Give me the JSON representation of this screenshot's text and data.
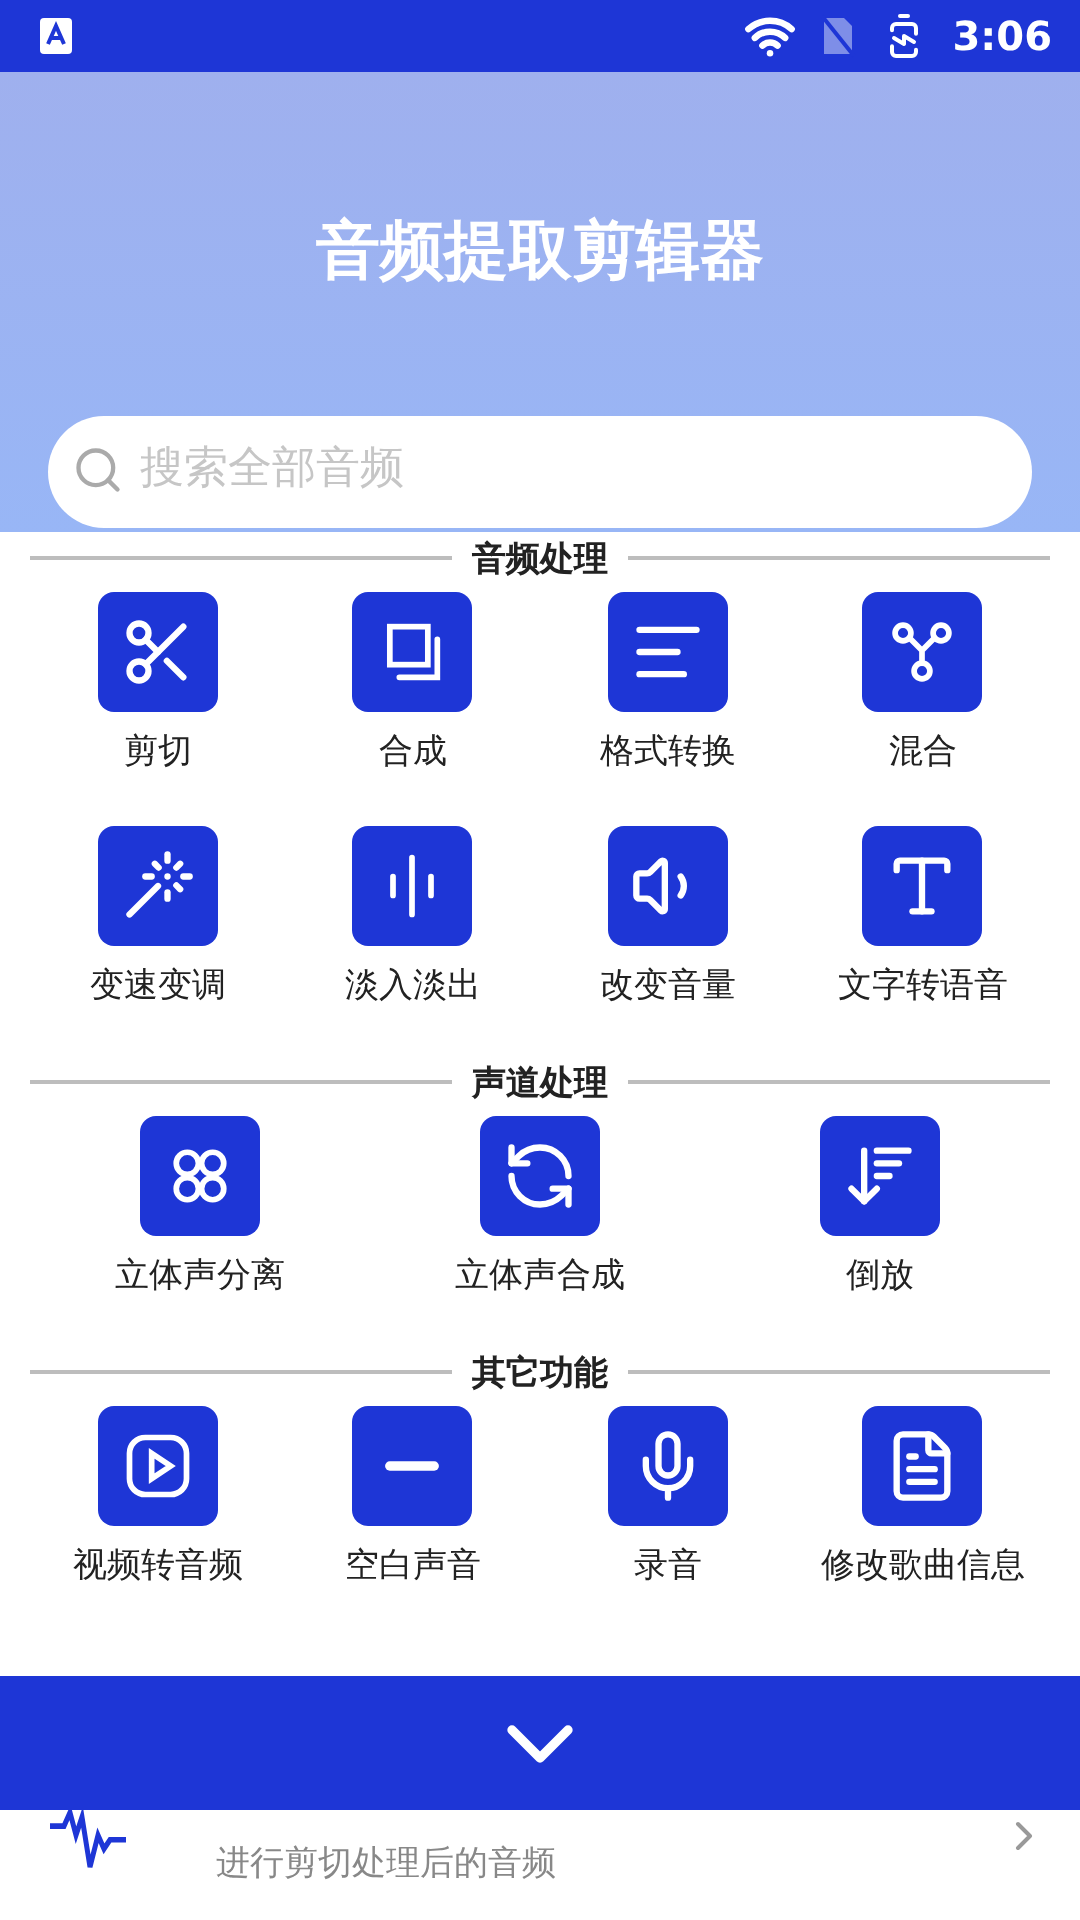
{
  "status_bar": {
    "time": "3:06"
  },
  "header": {
    "title": "音频提取剪辑器"
  },
  "search": {
    "placeholder": "搜索全部音频"
  },
  "sections": [
    {
      "title": "音频处理",
      "items": [
        {
          "label": "剪切"
        },
        {
          "label": "合成"
        },
        {
          "label": "格式转换"
        },
        {
          "label": "混合"
        },
        {
          "label": "变速变调"
        },
        {
          "label": "淡入淡出"
        },
        {
          "label": "改变音量"
        },
        {
          "label": "文字转语音"
        }
      ]
    },
    {
      "title": "声道处理",
      "items": [
        {
          "label": "立体声分离"
        },
        {
          "label": "立体声合成"
        },
        {
          "label": "倒放"
        }
      ]
    },
    {
      "title": "其它功能",
      "items": [
        {
          "label": "视频转音频"
        },
        {
          "label": "空白声音"
        },
        {
          "label": "录音"
        },
        {
          "label": "修改歌曲信息"
        }
      ]
    }
  ],
  "list": [
    {
      "subtitle": "进行剪切处理后的音频"
    }
  ]
}
